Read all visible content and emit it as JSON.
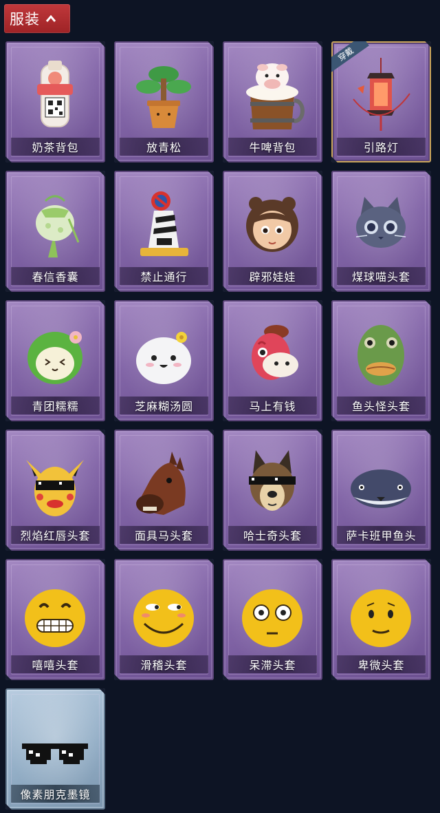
{
  "header": {
    "title": "服装",
    "chevron": "chevron-up-icon"
  },
  "badge_label": "穿戴",
  "items": [
    {
      "name": "奶茶背包",
      "icon": "milk-tea-backpack-icon"
    },
    {
      "name": "放青松",
      "icon": "potted-pine-icon"
    },
    {
      "name": "牛啤背包",
      "icon": "cow-beer-mug-icon"
    },
    {
      "name": "引路灯",
      "icon": "lantern-icon",
      "equipped": true
    },
    {
      "name": "春信香囊",
      "icon": "sachet-icon"
    },
    {
      "name": "禁止通行",
      "icon": "no-entry-cone-icon"
    },
    {
      "name": "辟邪娃娃",
      "icon": "doll-head-icon"
    },
    {
      "name": "煤球喵头套",
      "icon": "cat-head-icon"
    },
    {
      "name": "青团糯糯",
      "icon": "green-dumpling-icon"
    },
    {
      "name": "芝麻糊汤圆",
      "icon": "rice-ball-icon"
    },
    {
      "name": "马上有钱",
      "icon": "red-horse-icon"
    },
    {
      "name": "鱼头怪头套",
      "icon": "fish-mask-icon"
    },
    {
      "name": "烈焰红唇头套",
      "icon": "yellow-mask-icon"
    },
    {
      "name": "面具马头套",
      "icon": "horse-mask-icon"
    },
    {
      "name": "哈士奇头套",
      "icon": "husky-mask-icon"
    },
    {
      "name": "萨卡班甲鱼头",
      "icon": "sacabambaspis-icon"
    },
    {
      "name": "嘻嘻头套",
      "icon": "grin-emoji-icon"
    },
    {
      "name": "滑稽头套",
      "icon": "smirk-emoji-icon"
    },
    {
      "name": "呆滞头套",
      "icon": "stare-emoji-icon"
    },
    {
      "name": "卑微头套",
      "icon": "timid-emoji-icon"
    },
    {
      "name": "像素朋克墨镜",
      "icon": "pixel-sunglasses-icon",
      "rarity": "blue"
    }
  ]
}
